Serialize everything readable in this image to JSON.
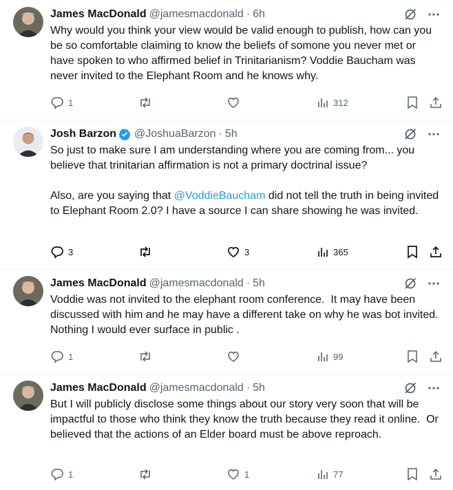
{
  "tweets": [
    {
      "name": "James MacDonald",
      "handle": "@jamesmacdonald",
      "time": "6h",
      "verified": false,
      "text_parts": [
        {
          "text": "Why would you think your view would be valid enough to publish, how can you be so comfortable claiming to know the beliefs of somone you never met or have spoken to who affirmed belief in Trinitarianism? Voddie Baucham was never invited to the Elephant Room and he knows why.",
          "mention": false
        }
      ],
      "replies": "1",
      "reposts": "",
      "likes": "",
      "views": "312"
    },
    {
      "name": "Josh Barzon",
      "handle": "@JoshuaBarzon",
      "time": "5h",
      "verified": true,
      "text_parts": [
        {
          "text": "So just to make sure I am understanding where you are coming from... you believe that trinitarian affirmation is not a primary doctrinal issue?\n\nAlso, are you saying that ",
          "mention": false
        },
        {
          "text": "@VoddieBaucham",
          "mention": true
        },
        {
          "text": " did not tell the truth in being invited to Elephant Room 2.0? I have a source I can share showing he was invited.",
          "mention": false
        }
      ],
      "replies": "3",
      "reposts": "",
      "likes": "3",
      "views": "365"
    },
    {
      "name": "James MacDonald",
      "handle": "@jamesmacdonald",
      "time": "5h",
      "verified": false,
      "text_parts": [
        {
          "text": "Voddie was not invited to the elephant room conference.  It may have been discussed with him and he may have a different take on why he was bot invited.  Nothing I would ever surface in public .",
          "mention": false
        }
      ],
      "replies": "1",
      "reposts": "",
      "likes": "",
      "views": "99"
    },
    {
      "name": "James MacDonald",
      "handle": "@jamesmacdonald",
      "time": "5h",
      "verified": false,
      "text_parts": [
        {
          "text": "But I will publicly disclose some things about our story very soon that will be  impactful to those who think they know the truth because they read it online.  Or believed that the actions of an Elder board must be above reproach.",
          "mention": false
        }
      ],
      "replies": "1",
      "reposts": "",
      "likes": "1",
      "views": "77"
    }
  ],
  "separator": "·",
  "colors": {
    "text": "#0f1419",
    "secondary": "#536471",
    "link": "#1d9bf0",
    "verified": "#1d9bf0",
    "divider": "#eff3f4"
  }
}
